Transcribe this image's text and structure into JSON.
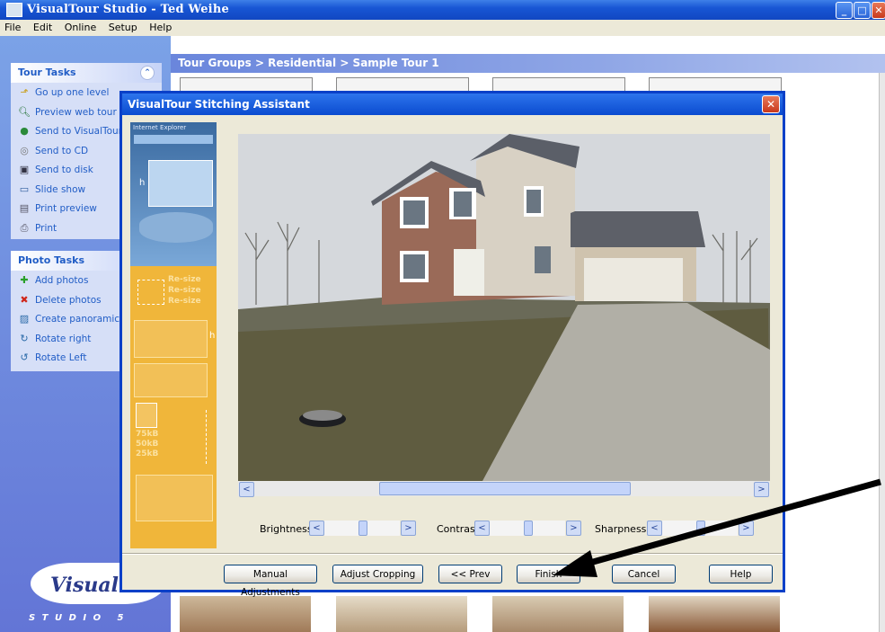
{
  "window": {
    "title": "VisualTour Studio - Ted Weihe"
  },
  "menu": [
    "File",
    "Edit",
    "Online",
    "Setup",
    "Help"
  ],
  "tour_tasks": {
    "header": "Tour Tasks",
    "items": [
      {
        "label": "Go up one level",
        "icon": "folder-up-icon"
      },
      {
        "label": "Preview web tour",
        "icon": "magnifier-icon"
      },
      {
        "label": "Send to VisualTour",
        "icon": "globe-icon"
      },
      {
        "label": "Send to CD",
        "icon": "cd-icon"
      },
      {
        "label": "Send to disk",
        "icon": "floppy-icon"
      },
      {
        "label": "Slide show",
        "icon": "slideshow-icon"
      },
      {
        "label": "Print preview",
        "icon": "print-preview-icon"
      },
      {
        "label": "Print",
        "icon": "printer-icon"
      }
    ]
  },
  "photo_tasks": {
    "header": "Photo Tasks",
    "items": [
      {
        "label": "Add photos",
        "icon": "add-icon"
      },
      {
        "label": "Delete photos",
        "icon": "delete-icon"
      },
      {
        "label": "Create panoramic",
        "icon": "panorama-icon"
      },
      {
        "label": "Rotate right",
        "icon": "rotate-right-icon"
      },
      {
        "label": "Rotate Left",
        "icon": "rotate-left-icon"
      }
    ]
  },
  "logo": {
    "text": "VisualTo",
    "studio": "S T U D I O   5"
  },
  "breadcrumb": "Tour Groups > Residential > Sample Tour 1",
  "dialog": {
    "title": "VisualTour Stitching Assistant",
    "strip_text": {
      "browser": "Internet Explorer",
      "resize": "Re-size",
      "sizes": [
        "75kB",
        "50kB",
        "25kB"
      ]
    },
    "sliders": {
      "brightness": "Brightness",
      "contrast": "Contrast",
      "sharpness": "Sharpness"
    },
    "buttons": {
      "manual": "Manual Adjustments",
      "crop": "Adjust Cropping",
      "prev": "<< Prev",
      "finish": "Finish",
      "cancel": "Cancel",
      "help": "Help"
    }
  }
}
